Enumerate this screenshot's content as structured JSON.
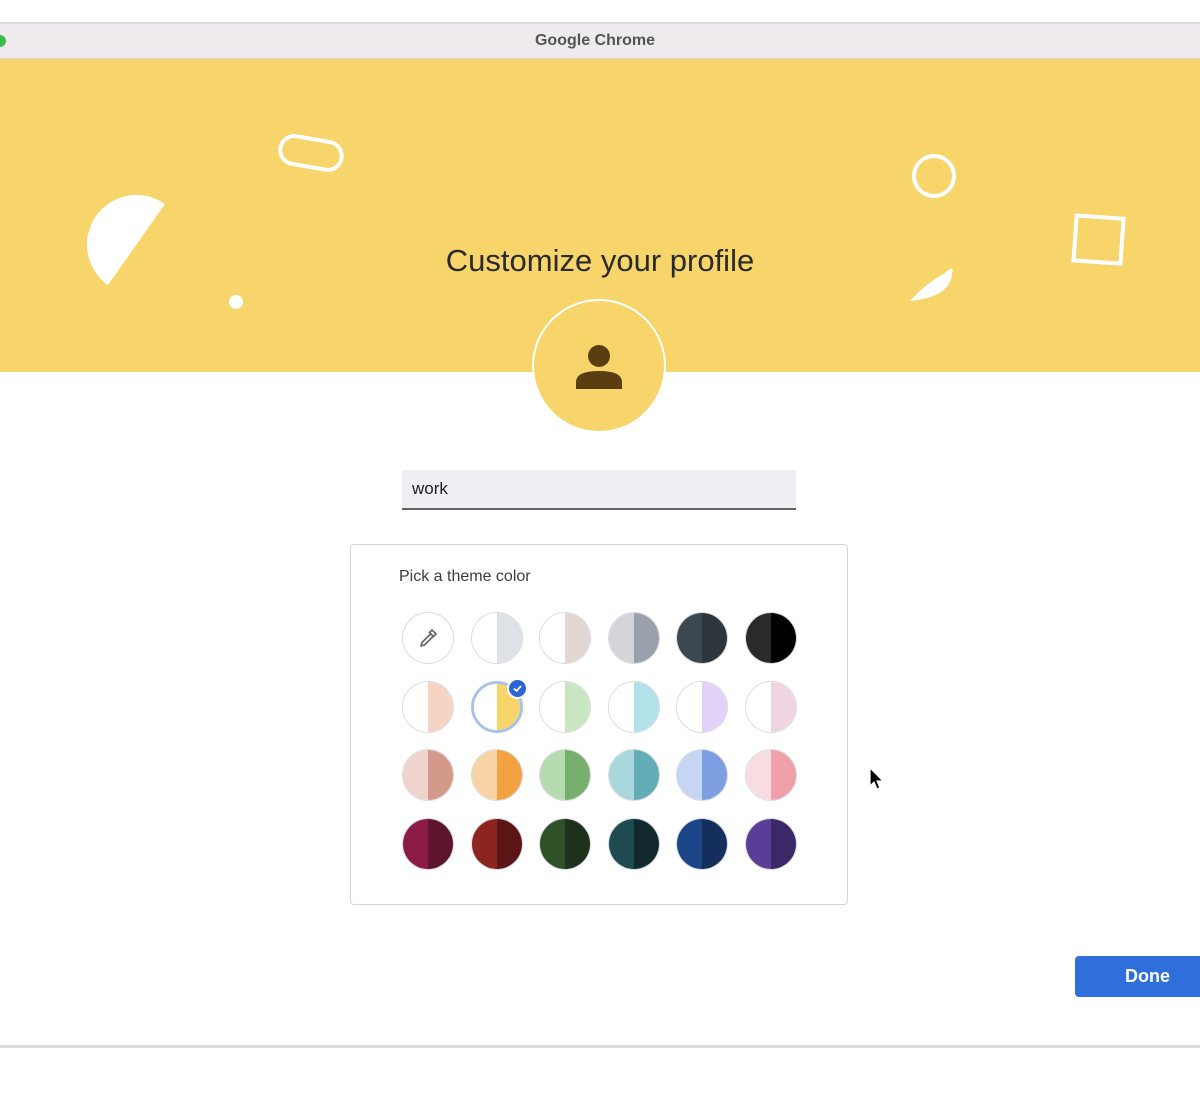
{
  "window": {
    "title": "Google Chrome"
  },
  "header": {
    "title": "Customize your profile"
  },
  "avatar": {
    "icon": "person-icon",
    "color": "#5a3e12"
  },
  "name_field": {
    "value": "work"
  },
  "theme": {
    "title": "Pick a theme color",
    "selected_index": 7,
    "swatches": [
      {
        "kind": "picker",
        "icon": "eyedropper-icon"
      },
      {
        "left": "#ffffff",
        "right": "#dee1e6"
      },
      {
        "left": "#ffffff",
        "right": "#e3d7d4"
      },
      {
        "left": "#d4d5d9",
        "right": "#9aa0ac"
      },
      {
        "left": "#3c4850",
        "right": "#2d363c"
      },
      {
        "left": "#2a2a2a",
        "right": "#000000"
      },
      {
        "left": "#ffffff",
        "right": "#f6d4c3"
      },
      {
        "left": "#ffffff",
        "right": "#f8d56b"
      },
      {
        "left": "#ffffff",
        "right": "#c8e6c1"
      },
      {
        "left": "#ffffff",
        "right": "#b2e1e9"
      },
      {
        "left": "#ffffff",
        "right": "#e2d2f7"
      },
      {
        "left": "#ffffff",
        "right": "#f1d4e2"
      },
      {
        "left": "#eed4cd",
        "right": "#d3998a"
      },
      {
        "left": "#f8d3a6",
        "right": "#f2a243"
      },
      {
        "left": "#b7dbb0",
        "right": "#77b06c"
      },
      {
        "left": "#a9d7dc",
        "right": "#63adb7"
      },
      {
        "left": "#c6d6f2",
        "right": "#7d9ee0"
      },
      {
        "left": "#f7dde2",
        "right": "#f0a0ab"
      },
      {
        "left": "#8c1b48",
        "right": "#5d142f"
      },
      {
        "left": "#8c2420",
        "right": "#5c1615"
      },
      {
        "left": "#2f5127",
        "right": "#1d311c"
      },
      {
        "left": "#1d4b50",
        "right": "#12292d"
      },
      {
        "left": "#1c4687",
        "right": "#142f5e"
      },
      {
        "left": "#593d97",
        "right": "#3b2866"
      }
    ]
  },
  "actions": {
    "done_label": "Done"
  }
}
